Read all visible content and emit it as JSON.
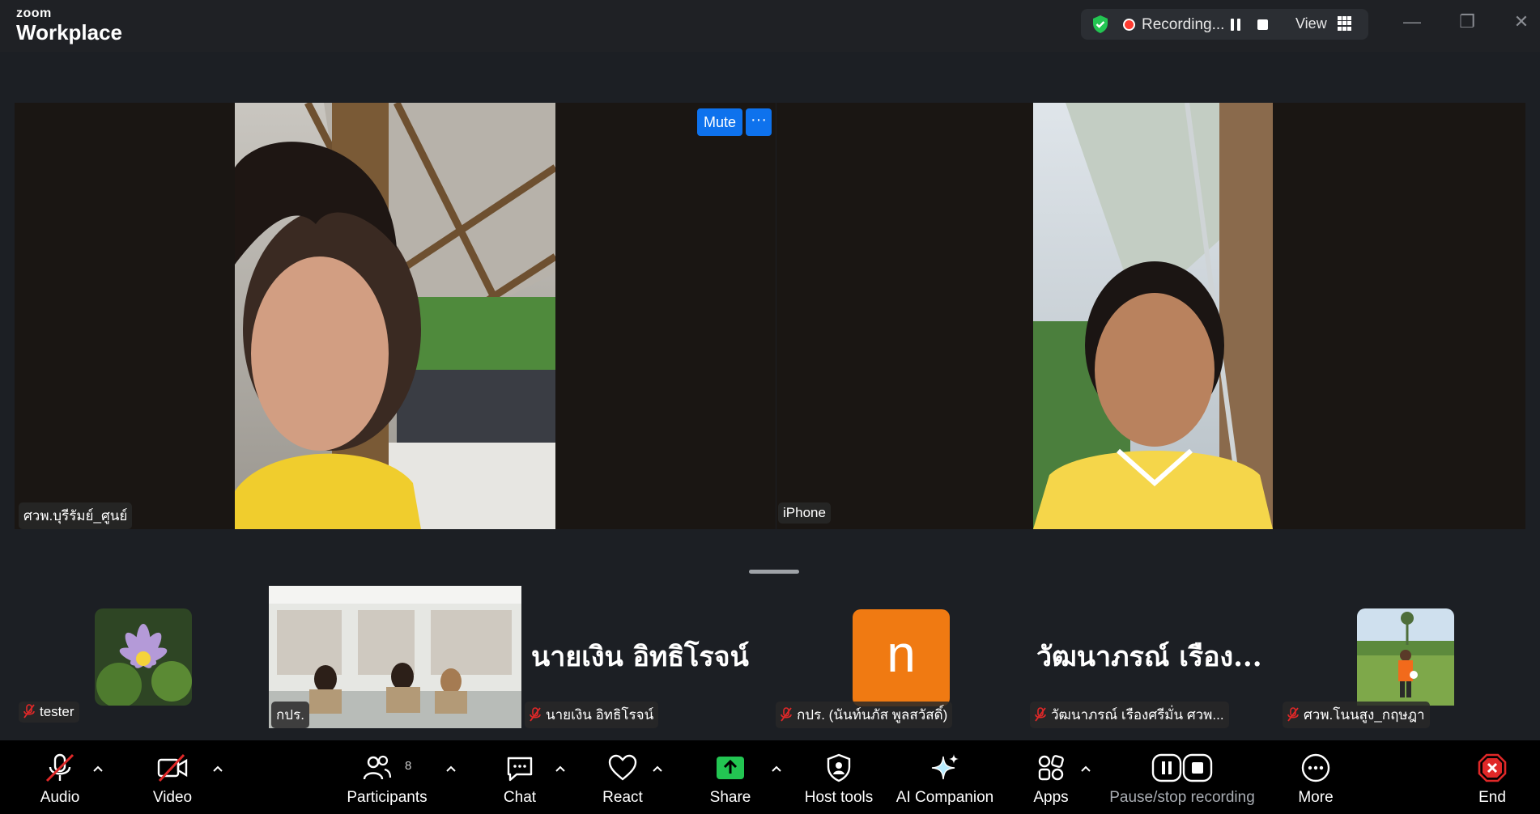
{
  "app": {
    "brand_small": "zoom",
    "brand_large": "Workplace"
  },
  "recording": {
    "status": "Recording...",
    "view_label": "View",
    "colors": {
      "shield": "#23c552",
      "dot": "#ff3b30"
    }
  },
  "window_controls": {
    "minimize": "—",
    "restore": "❐",
    "close": "✕"
  },
  "spotlight": {
    "tiles": [
      {
        "name": "ศวพ.บุรีรัมย์_ศูนย์"
      },
      {
        "name": "iPhone"
      }
    ],
    "mute_button": "Mute",
    "more_button": "···"
  },
  "gallery": [
    {
      "name": "tester",
      "type": "photo"
    },
    {
      "name": "กปร.",
      "type": "video"
    },
    {
      "name": "นายเงิน  อิทธิโรจน์",
      "display": "นายเงิน  อิทธิโรจน์",
      "type": "name"
    },
    {
      "name": "กปร. (นันท์นภัส พูลสวัสดิ์)",
      "avatar_letter": "n",
      "type": "avatar"
    },
    {
      "name": "วัฒนาภรณ์  เรืองศรีมั่น ศวพ...",
      "display": "วัฒนาภรณ์  เรือง...",
      "type": "name"
    },
    {
      "name": "ศวพ.โนนสูง_กฤษฎา",
      "type": "photo"
    }
  ],
  "toolbar": {
    "audio": "Audio",
    "video": "Video",
    "participants": "Participants",
    "participants_count": "8",
    "chat": "Chat",
    "react": "React",
    "share": "Share",
    "host_tools": "Host tools",
    "ai_companion": "AI Companion",
    "apps": "Apps",
    "pause_stop": "Pause/stop recording",
    "more": "More",
    "end": "End",
    "colors": {
      "share": "#23c552",
      "end": "#e02828",
      "muted": "#e02828"
    }
  }
}
